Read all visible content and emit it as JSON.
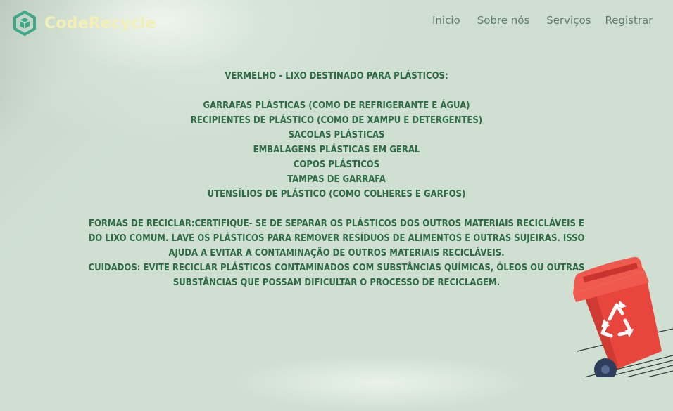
{
  "header": {
    "brand": "CodeRecycle",
    "nav": [
      "Inicio",
      "Sobre nós",
      "Serviços",
      "Registrar"
    ]
  },
  "content": {
    "heading": "VERMELHO - LIXO DESTINADO PARA PLÁSTICOS:",
    "items": [
      "GARRAFAS PLÁSTICAS (COMO DE REFRIGERANTE E ÁGUA)",
      "RECIPIENTES DE PLÁSTICO (COMO DE XAMPU E DETERGENTES)",
      "SACOLAS PLÁSTICAS",
      "EMBALAGENS PLÁSTICAS EM GERAL",
      "COPOS PLÁSTICOS",
      "TAMPAS DE GARRAFA",
      "UTENSÍLIOS DE PLÁSTICO (COMO COLHERES E GARFOS)"
    ],
    "text_lines": [
      "FORMAS DE RECICLAR:CERTIFIQUE- SE DE SEPARAR OS PLÁSTICOS DOS OUTROS MATERIAIS RECICLÁVEIS E",
      "DO LIXO COMUM. LAVE OS PLÁSTICOS PARA REMOVER RESÍDUOS DE ALIMENTOS E OUTRAS SUJEIRAS. ISSO",
      "AJUDA A EVITAR A CONTAMINAÇÃO DE OUTROS MATERIAIS RECICLÁVEIS.",
      "CUIDADOS: EVITE RECICLAR PLÁSTICOS CONTAMINADOS COM SUBSTÂNCIAS QUÍMICAS, ÓLEOS OU OUTRAS",
      "SUBSTÂNCIAS QUE POSSAM DIFICULTAR O PROCESSO DE RECICLAGEM."
    ]
  },
  "icons": {
    "logo": "recycle-cube-icon",
    "bin": "red-recycling-bin-icon"
  },
  "colors": {
    "background": "#cfe0d3",
    "brand_text": "#f2f0b4",
    "nav_text": "#5f7a70",
    "body_text": "#2f6b45",
    "bin_red": "#e8453c"
  }
}
